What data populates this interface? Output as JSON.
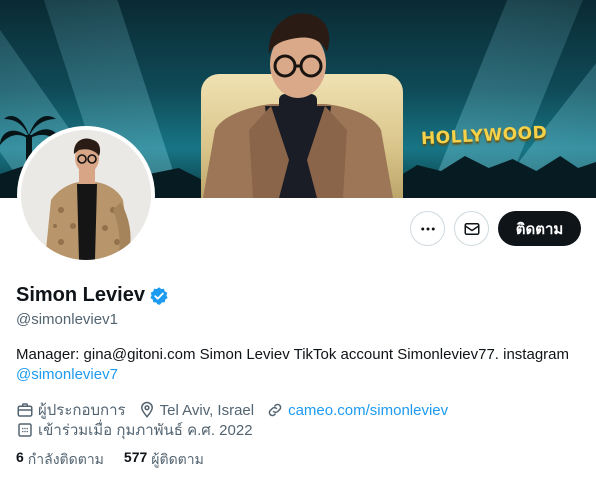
{
  "banner": {
    "sign_text": "HOLLYWOOD"
  },
  "actions": {
    "more_icon": "more-horizontal-icon",
    "message_icon": "envelope-icon",
    "follow_label": "ติดตาม"
  },
  "profile": {
    "name": "Simon Leviev",
    "verified_icon": "verified-badge-icon",
    "handle": "@simonleviev1",
    "bio_text": "Manager: gina@gitoni.com Simon Leviev TikTok account Simonleviev77. instagram",
    "bio_link": "@simonleviev7",
    "category": "ผู้ประกอบการ",
    "location": "Tel Aviv, Israel",
    "website": "cameo.com/simonleviev",
    "joined": "เข้าร่วมเมื่อ กุมภาพันธ์ ค.ศ. 2022"
  },
  "stats": {
    "following_count": "6",
    "following_label": "กำลังติดตาม",
    "followers_count": "577",
    "followers_label": "ผู้ติดตาม"
  },
  "colors": {
    "accent": "#1d9bf0",
    "text_primary": "#0f1419",
    "text_secondary": "#536471",
    "button_dark": "#0f1419",
    "border": "#cfd9de"
  }
}
